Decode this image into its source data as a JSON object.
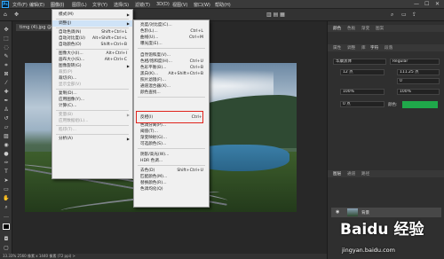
{
  "menubar": {
    "logo": "Ps",
    "items": [
      "文件(F)",
      "编辑(E)",
      "图像(I)",
      "图层(L)",
      "文字(Y)",
      "选择(S)",
      "滤镜(T)",
      "3D(D)",
      "视图(V)",
      "窗口(W)",
      "帮助(H)"
    ],
    "window_buttons": [
      "—",
      "☐",
      "✕"
    ]
  },
  "document": {
    "tab_label": "timg (4).jpg @ 33.3%(RGB/8#)",
    "close": "×"
  },
  "status": {
    "text": "33.33%   2560 像素 x 1440 像素 (72 ppi)   >"
  },
  "image_menu": {
    "items": [
      {
        "label": "模式(M)",
        "shortcut": "",
        "submenu": true,
        "disabled": false
      },
      {
        "label": "调整(J)",
        "shortcut": "",
        "submenu": true,
        "disabled": false,
        "highlight": true
      },
      {
        "label": "自动色调(N)",
        "shortcut": "Shift+Ctrl+L",
        "disabled": false
      },
      {
        "label": "自动对比度(U)",
        "shortcut": "Alt+Shift+Ctrl+L",
        "disabled": false
      },
      {
        "label": "自动颜色(O)",
        "shortcut": "Shift+Ctrl+B",
        "disabled": false
      },
      {
        "label": "图像大小(I)...",
        "shortcut": "Alt+Ctrl+I",
        "disabled": false
      },
      {
        "label": "画布大小(S)...",
        "shortcut": "Alt+Ctrl+C",
        "disabled": false
      },
      {
        "label": "图像旋转(G)",
        "shortcut": "",
        "submenu": true,
        "disabled": false
      },
      {
        "label": "裁剪(P)",
        "shortcut": "",
        "disabled": true
      },
      {
        "label": "裁切(R)...",
        "shortcut": "",
        "disabled": false
      },
      {
        "label": "显示全部(V)",
        "shortcut": "",
        "disabled": true
      },
      {
        "label": "复制(D)...",
        "shortcut": "",
        "disabled": false
      },
      {
        "label": "应用图像(Y)...",
        "shortcut": "",
        "disabled": false
      },
      {
        "label": "计算(C)...",
        "shortcut": "",
        "disabled": false
      },
      {
        "label": "变量(B)",
        "shortcut": "",
        "submenu": true,
        "disabled": true
      },
      {
        "label": "应用数据组(L)...",
        "shortcut": "",
        "disabled": true
      },
      {
        "label": "陷印(T)...",
        "shortcut": "",
        "disabled": true
      },
      {
        "label": "分析(A)",
        "shortcut": "",
        "submenu": true,
        "disabled": false
      }
    ]
  },
  "adjust_menu": {
    "items": [
      {
        "label": "亮度/对比度(C)...",
        "shortcut": ""
      },
      {
        "label": "色阶(L)...",
        "shortcut": "Ctrl+L"
      },
      {
        "label": "曲线(U)...",
        "shortcut": "Ctrl+M"
      },
      {
        "label": "曝光度(E)...",
        "shortcut": ""
      },
      {
        "label": "自然饱和度(V)...",
        "shortcut": ""
      },
      {
        "label": "色相/饱和度(H)...",
        "shortcut": "Ctrl+U"
      },
      {
        "label": "色彩平衡(B)...",
        "shortcut": "Ctrl+B"
      },
      {
        "label": "黑白(K)...",
        "shortcut": "Alt+Shift+Ctrl+B"
      },
      {
        "label": "照片滤镜(F)...",
        "shortcut": ""
      },
      {
        "label": "通道混合器(X)...",
        "shortcut": ""
      },
      {
        "label": "颜色查找...",
        "shortcut": ""
      },
      {
        "label": "反相(I)",
        "shortcut": "Ctrl+I",
        "boxed": true
      },
      {
        "label": "色调分离(P)...",
        "shortcut": ""
      },
      {
        "label": "阈值(T)...",
        "shortcut": ""
      },
      {
        "label": "渐变映射(G)...",
        "shortcut": ""
      },
      {
        "label": "可选颜色(S)...",
        "shortcut": ""
      },
      {
        "label": "阴影/高光(W)...",
        "shortcut": ""
      },
      {
        "label": "HDR 色调...",
        "shortcut": ""
      },
      {
        "label": "去色(D)",
        "shortcut": "Shift+Ctrl+U"
      },
      {
        "label": "匹配颜色(M)...",
        "shortcut": ""
      },
      {
        "label": "替换颜色(R)...",
        "shortcut": ""
      },
      {
        "label": "色调均化(Q)",
        "shortcut": ""
      }
    ]
  },
  "right_panel": {
    "tabs_top": [
      "颜色",
      "色板",
      "渐变",
      "图案"
    ],
    "tabs_mid": [
      "属性",
      "调整",
      "库",
      "字符",
      "段落"
    ],
    "font_family": "华康黑体",
    "font_style": "Regular",
    "font_size": "12 点",
    "leading": "111.25 点",
    "tracking": "0",
    "scale_v": "100%",
    "scale_h": "100%",
    "baseline": "0 点",
    "color_label": "颜色:",
    "layers_tabs": [
      "图层",
      "通道",
      "路径"
    ],
    "layer_name": "背景"
  },
  "watermark": {
    "logo": "Baidu 经验",
    "url": "jingyan.baidu.com"
  },
  "colors": {
    "highlight": "#cfe3f7",
    "red_box": "#e0231c",
    "swatch": "#1fa84a"
  }
}
